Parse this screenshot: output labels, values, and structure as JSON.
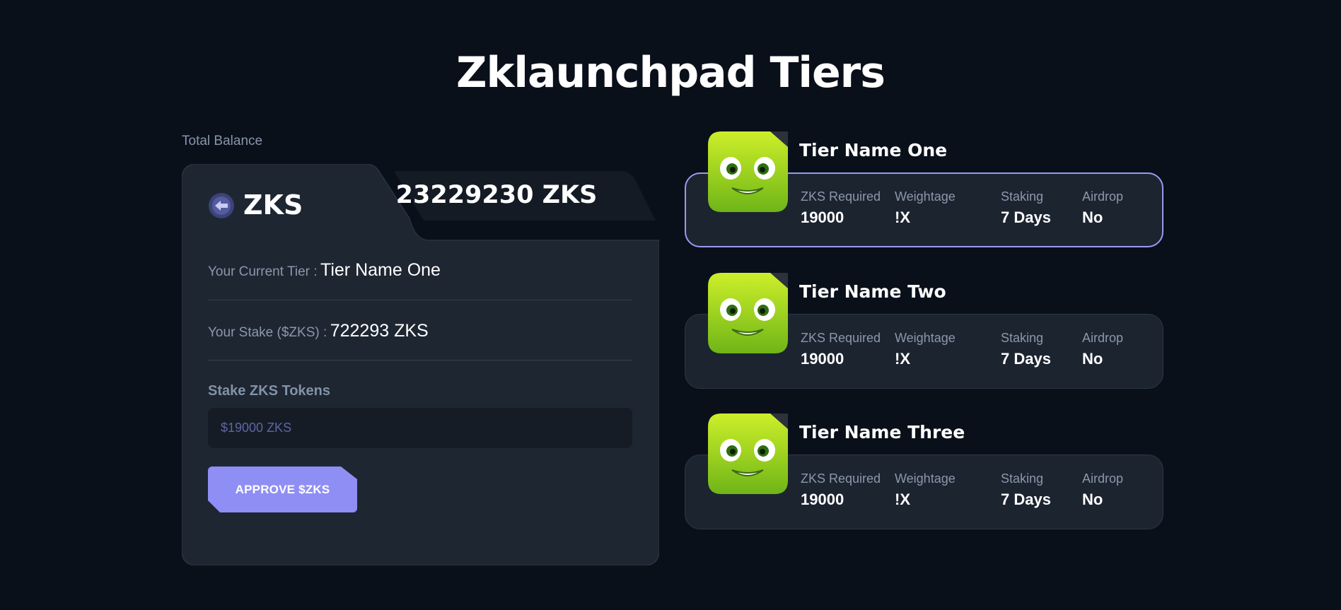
{
  "page": {
    "title": "Zklaunchpad Tiers"
  },
  "balance_card": {
    "label": "Total Balance",
    "token_name": "ZKS",
    "balance": "23229230 ZKS",
    "current_tier_label": "Your Current Tier :",
    "current_tier_value": "Tier Name One",
    "stake_label": "Your Stake ($ZKS) :",
    "stake_value": "722293 ZKS",
    "stake_title": "Stake ZKS Tokens",
    "stake_input_placeholder": "$19000 ZKS",
    "stake_input_value": "",
    "approve_label": "APPROVE $ZKS"
  },
  "tiers": [
    {
      "name": "Tier Name One",
      "active": true,
      "stats": [
        {
          "label": "ZKS Required",
          "value": "19000"
        },
        {
          "label": "Weightage",
          "value": "!X"
        },
        {
          "label": "Staking",
          "value": "7 Days"
        },
        {
          "label": "Airdrop",
          "value": "No"
        }
      ]
    },
    {
      "name": "Tier Name Two",
      "active": false,
      "stats": [
        {
          "label": "ZKS Required",
          "value": "19000"
        },
        {
          "label": "Weightage",
          "value": "!X"
        },
        {
          "label": "Staking",
          "value": "7 Days"
        },
        {
          "label": "Airdrop",
          "value": "No"
        }
      ]
    },
    {
      "name": "Tier Name Three",
      "active": false,
      "stats": [
        {
          "label": "ZKS Required",
          "value": "19000"
        },
        {
          "label": "Weightage",
          "value": "!X"
        },
        {
          "label": "Staking",
          "value": "7 Days"
        },
        {
          "label": "Airdrop",
          "value": "No"
        }
      ]
    }
  ],
  "colors": {
    "background": "#0a101a",
    "card": "#1e2632",
    "accent": "#8f8ef5",
    "active_border": "#9a9af0",
    "mascot_green": "#a4d81a"
  },
  "icons": {
    "token": "zks-token-icon",
    "tier_avatar": "green-mascot-avatar"
  }
}
